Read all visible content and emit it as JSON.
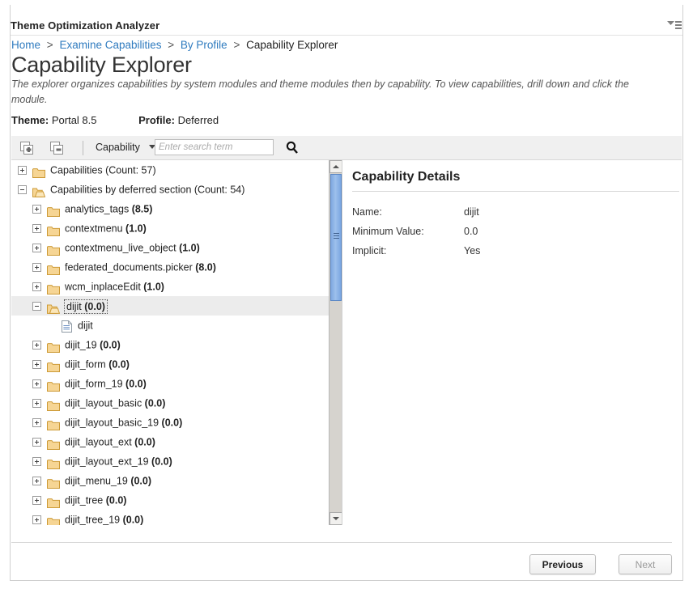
{
  "app": {
    "title": "Theme Optimization Analyzer",
    "menu_icon": "filter-menu-icon"
  },
  "breadcrumb": {
    "items": [
      {
        "label": "Home",
        "link": true
      },
      {
        "label": "Examine Capabilities",
        "link": true
      },
      {
        "label": "By Profile",
        "link": true
      },
      {
        "label": "Capability Explorer",
        "link": false
      }
    ],
    "separator": ">"
  },
  "page": {
    "title": "Capability Explorer",
    "description": "The explorer organizes capabilities by system modules and theme modules then by capability. To view capabilities, drill down and click the module."
  },
  "meta": {
    "theme_label": "Theme:",
    "theme_value": "Portal 8.5",
    "profile_label": "Profile:",
    "profile_value": "Deferred"
  },
  "toolbar": {
    "expand_all_icon": "expand-all-icon",
    "collapse_all_icon": "collapse-all-icon",
    "filter_select": "Capability",
    "search_placeholder": "Enter search term",
    "search_value": "",
    "search_icon": "search-icon"
  },
  "tree": {
    "rows": [
      {
        "indent": 0,
        "toggle": "plus",
        "icon": "folder-closed",
        "text": "Capabilities (Count: 57)",
        "bold": "",
        "selected": false
      },
      {
        "indent": 0,
        "toggle": "minus",
        "icon": "folder-open",
        "text": "Capabilities by deferred section (Count: 54)",
        "bold": "",
        "selected": false
      },
      {
        "indent": 1,
        "toggle": "plus",
        "icon": "folder-closed",
        "text": "analytics_tags ",
        "bold": "(8.5)",
        "selected": false
      },
      {
        "indent": 1,
        "toggle": "plus",
        "icon": "folder-closed",
        "text": "contextmenu ",
        "bold": "(1.0)",
        "selected": false
      },
      {
        "indent": 1,
        "toggle": "plus",
        "icon": "folder-closed",
        "text": "contextmenu_live_object ",
        "bold": "(1.0)",
        "selected": false
      },
      {
        "indent": 1,
        "toggle": "plus",
        "icon": "folder-closed",
        "text": "federated_documents.picker ",
        "bold": "(8.0)",
        "selected": false
      },
      {
        "indent": 1,
        "toggle": "plus",
        "icon": "folder-closed",
        "text": "wcm_inplaceEdit ",
        "bold": "(1.0)",
        "selected": false
      },
      {
        "indent": 1,
        "toggle": "minus",
        "icon": "folder-open",
        "text": "dijit ",
        "bold": "(0.0)",
        "selected": true
      },
      {
        "indent": 2,
        "toggle": "none",
        "icon": "document",
        "text": "dijit",
        "bold": "",
        "selected": false
      },
      {
        "indent": 1,
        "toggle": "plus",
        "icon": "folder-closed",
        "text": "dijit_19 ",
        "bold": "(0.0)",
        "selected": false
      },
      {
        "indent": 1,
        "toggle": "plus",
        "icon": "folder-closed",
        "text": "dijit_form ",
        "bold": "(0.0)",
        "selected": false
      },
      {
        "indent": 1,
        "toggle": "plus",
        "icon": "folder-closed",
        "text": "dijit_form_19 ",
        "bold": "(0.0)",
        "selected": false
      },
      {
        "indent": 1,
        "toggle": "plus",
        "icon": "folder-closed",
        "text": "dijit_layout_basic ",
        "bold": "(0.0)",
        "selected": false
      },
      {
        "indent": 1,
        "toggle": "plus",
        "icon": "folder-closed",
        "text": "dijit_layout_basic_19 ",
        "bold": "(0.0)",
        "selected": false
      },
      {
        "indent": 1,
        "toggle": "plus",
        "icon": "folder-closed",
        "text": "dijit_layout_ext ",
        "bold": "(0.0)",
        "selected": false
      },
      {
        "indent": 1,
        "toggle": "plus",
        "icon": "folder-closed",
        "text": "dijit_layout_ext_19 ",
        "bold": "(0.0)",
        "selected": false
      },
      {
        "indent": 1,
        "toggle": "plus",
        "icon": "folder-closed",
        "text": "dijit_menu_19 ",
        "bold": "(0.0)",
        "selected": false
      },
      {
        "indent": 1,
        "toggle": "plus",
        "icon": "folder-closed",
        "text": "dijit_tree ",
        "bold": "(0.0)",
        "selected": false
      },
      {
        "indent": 1,
        "toggle": "plus",
        "icon": "folder-closed",
        "text": "dijit_tree_19 ",
        "bold": "(0.0)",
        "selected": false
      }
    ]
  },
  "details": {
    "heading": "Capability Details",
    "rows": [
      {
        "label": "Name:",
        "value": "dijit"
      },
      {
        "label": "Minimum Value:",
        "value": "0.0"
      },
      {
        "label": "Implicit:",
        "value": "Yes"
      }
    ]
  },
  "footer": {
    "previous_label": "Previous",
    "next_label": "Next"
  },
  "colors": {
    "link": "#2f7bbf",
    "folder": "#f0c368",
    "scroll_thumb": "#8fb4e8",
    "toolbar_bg": "#f0f0f0",
    "selected_row": "#ececec"
  }
}
